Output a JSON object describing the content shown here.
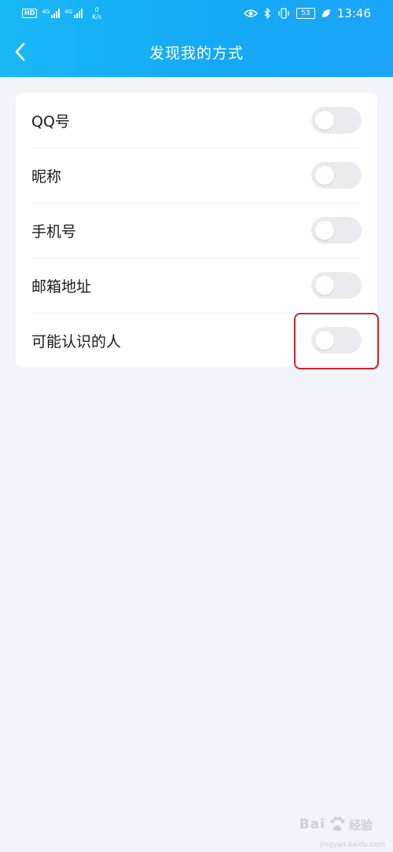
{
  "status_bar": {
    "hd_badge": "HD",
    "sim1_label": "4G",
    "sim2_label": "4G",
    "net_speed_value": "0",
    "net_speed_unit": "K/s",
    "battery": "53",
    "time": "13:46"
  },
  "header": {
    "title": "发现我的方式"
  },
  "settings": {
    "items": [
      {
        "label": "QQ号",
        "enabled": false
      },
      {
        "label": "昵称",
        "enabled": false
      },
      {
        "label": "手机号",
        "enabled": false
      },
      {
        "label": "邮箱地址",
        "enabled": false
      },
      {
        "label": "可能认识的人",
        "enabled": false
      }
    ]
  },
  "watermark": {
    "brand": "Bai",
    "brand_suffix": "经验",
    "url": "jingyan.baidu.com"
  },
  "colors": {
    "header_accent": "#14a9f5",
    "toggle_off": "#e9ebef",
    "highlight": "#c8262d",
    "background": "#f2f4f9"
  }
}
